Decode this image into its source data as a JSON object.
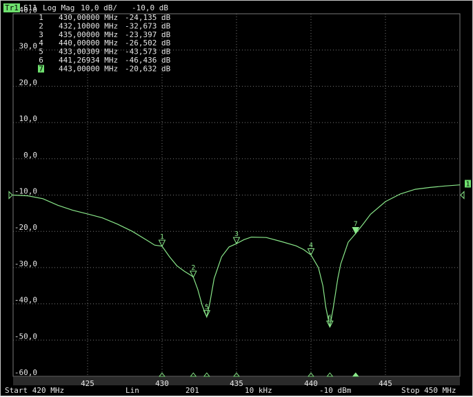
{
  "header": {
    "trace_badge": "Tr1",
    "parameter": "S11",
    "format": "Log Mag",
    "scale": "10,0 dB/",
    "reference": "-10,0 dB"
  },
  "marker_table": [
    {
      "id": "1",
      "freq": "430,00000 MHz",
      "value": "-24,135 dB"
    },
    {
      "id": "2",
      "freq": "432,10000 MHz",
      "value": "-32,673 dB"
    },
    {
      "id": "3",
      "freq": "435,00000 MHz",
      "value": "-23,397 dB"
    },
    {
      "id": "4",
      "freq": "440,00000 MHz",
      "value": "-26,502 dB"
    },
    {
      "id": "5",
      "freq": "433,00309 MHz",
      "value": "-43,573 dB"
    },
    {
      "id": "6",
      "freq": "441,26934 MHz",
      "value": "-46,436 dB"
    },
    {
      "id": "7",
      "freq": "443,00000 MHz",
      "value": "-20,632 dB",
      "active": true
    }
  ],
  "footer": {
    "start": "Start 420 MHz",
    "sweep_type": "Lin",
    "points": "201",
    "ifbw": "10 kHz",
    "power": "-10 dBm",
    "stop": "Stop 450 MHz"
  },
  "colors": {
    "trace": "#8ae88a",
    "trace_badge_bg": "#6ee06e",
    "grid": "#7a7a7a",
    "text": "#e6e6e6",
    "background": "#000000"
  },
  "chart_data": {
    "type": "line",
    "xlim": [
      420,
      450
    ],
    "ylim": [
      -60,
      40
    ],
    "x_ticks": [
      425,
      430,
      435,
      440,
      445
    ],
    "x_tick_labels": [
      "425",
      "430",
      "435",
      "440",
      "445"
    ],
    "y_ticks": [
      40,
      30,
      20,
      10,
      0,
      -10,
      -20,
      -30,
      -40,
      -50,
      -60
    ],
    "y_tick_labels": [
      "40,0",
      "30,0",
      "20,0",
      "10,0",
      "0,0",
      "-10,0",
      "-20,0",
      "-30,0",
      "-40,0",
      "-50,0",
      "-60,0"
    ],
    "reference_level": -10,
    "reference_label": "1",
    "grid": true,
    "series": [
      {
        "x": [
          420,
          421,
          422,
          423,
          424,
          425,
          426,
          427,
          428,
          429,
          429.5,
          430,
          430.5,
          431,
          431.5,
          432,
          432.1,
          432.4,
          432.7,
          433.0,
          433.2,
          433.5,
          434,
          434.5,
          435,
          435.5,
          436,
          437,
          438,
          439,
          439.5,
          440,
          440.5,
          440.8,
          441.0,
          441.27,
          441.5,
          441.8,
          442,
          442.5,
          443,
          443.5,
          444,
          445,
          446,
          447,
          448,
          449,
          450
        ],
        "y": [
          -10.0,
          -10.2,
          -11.0,
          -12.8,
          -14.2,
          -15.2,
          -16.3,
          -18.0,
          -20.0,
          -22.5,
          -23.8,
          -24.1,
          -27.0,
          -29.5,
          -31.0,
          -32.3,
          -32.7,
          -36.0,
          -40.5,
          -43.6,
          -40.0,
          -33.0,
          -27.0,
          -24.3,
          -23.4,
          -22.3,
          -21.6,
          -21.7,
          -22.8,
          -24.0,
          -25.0,
          -26.5,
          -30.0,
          -35.0,
          -41.0,
          -46.4,
          -41.0,
          -33.0,
          -29.0,
          -23.0,
          -20.6,
          -18.0,
          -15.3,
          -11.8,
          -9.7,
          -8.4,
          -7.9,
          -7.5,
          -7.2
        ]
      }
    ],
    "markers": [
      {
        "label": "1",
        "x": 430.0,
        "y": -24.135
      },
      {
        "label": "2",
        "x": 432.1,
        "y": -32.673
      },
      {
        "label": "3",
        "x": 435.0,
        "y": -23.397
      },
      {
        "label": "4",
        "x": 440.0,
        "y": -26.502
      },
      {
        "label": "5",
        "x": 433.00309,
        "y": -43.573
      },
      {
        "label": "6",
        "x": 441.26934,
        "y": -46.436
      },
      {
        "label": "7",
        "x": 443.0,
        "y": -20.632,
        "active": true
      }
    ]
  }
}
